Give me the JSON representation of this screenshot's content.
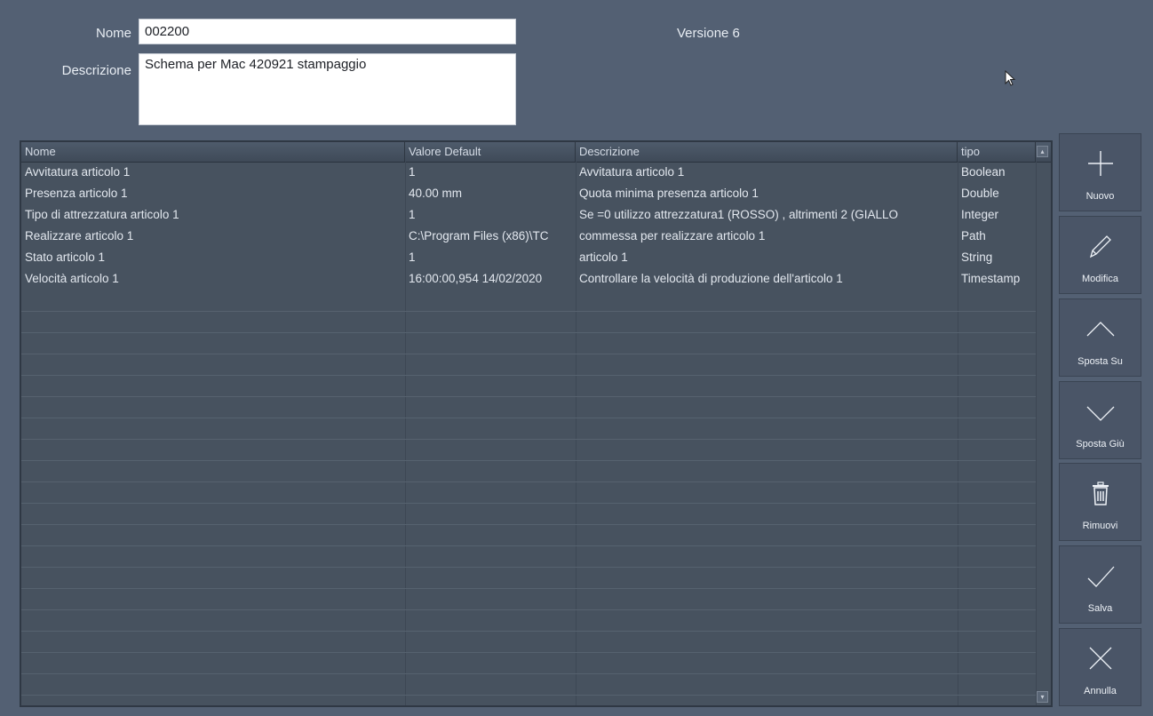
{
  "form": {
    "name_label": "Nome",
    "name_value": "002200",
    "description_label": "Descrizione",
    "description_value": "Schema per Mac 420921 stampaggio",
    "version_text": "Versione 6"
  },
  "table": {
    "columns": [
      "Nome",
      "Valore Default",
      "Descrizione",
      "tipo"
    ],
    "rows": [
      [
        "Avvitatura articolo 1",
        "1",
        "Avvitatura articolo 1",
        "Boolean"
      ],
      [
        "Presenza articolo 1",
        "40.00 mm",
        "Quota minima presenza articolo 1",
        "Double"
      ],
      [
        "Tipo di attrezzatura articolo 1",
        "1",
        "Se =0 utilizzo attrezzatura1 (ROSSO) , altrimenti 2 (GIALLO",
        "Integer"
      ],
      [
        "Realizzare articolo 1",
        "C:\\Program Files (x86)\\TC",
        "commessa per realizzare articolo 1",
        "Path"
      ],
      [
        "Stato articolo 1",
        "1",
        "articolo 1",
        "String"
      ],
      [
        "Velocità articolo 1",
        "16:00:00,954 14/02/2020",
        "Controllare la velocità di produzione dell'articolo 1",
        "Timestamp"
      ]
    ]
  },
  "toolbar": {
    "new_label": "Nuovo",
    "edit_label": "Modifica",
    "move_up_label": "Sposta Su",
    "move_down_label": "Sposta Giù",
    "remove_label": "Rimuovi",
    "save_label": "Salva",
    "cancel_label": "Annulla"
  },
  "icons": {
    "new": "plus-icon",
    "edit": "pencil-icon",
    "move_up": "chevron-up-icon",
    "move_down": "chevron-down-icon",
    "remove": "trash-icon",
    "save": "checkmark-icon",
    "cancel": "close-icon"
  },
  "colors": {
    "background": "#536073",
    "grid_background": "#47525f",
    "button_background": "#4a5567",
    "text": "#e3e8ef"
  }
}
